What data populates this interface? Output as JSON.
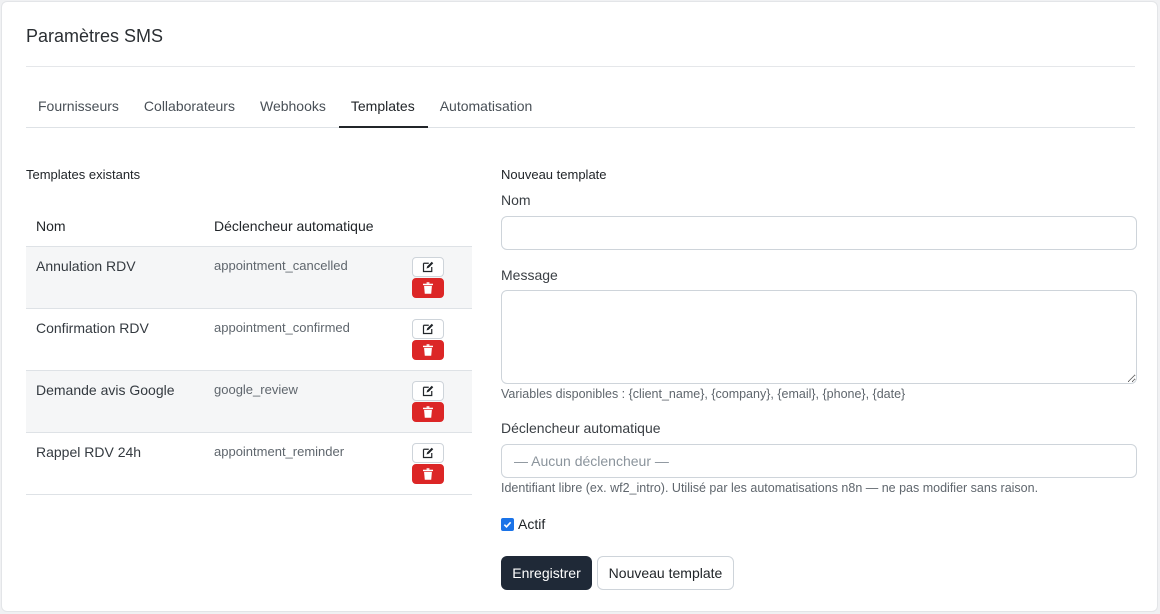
{
  "page": {
    "title": "Paramètres SMS"
  },
  "tabs": [
    {
      "label": "Fournisseurs",
      "active": false
    },
    {
      "label": "Collaborateurs",
      "active": false
    },
    {
      "label": "Webhooks",
      "active": false
    },
    {
      "label": "Templates",
      "active": true
    },
    {
      "label": "Automatisation",
      "active": false
    }
  ],
  "templates": {
    "heading": "Templates existants",
    "columns": {
      "name": "Nom",
      "trigger": "Déclencheur automatique"
    },
    "rows": [
      {
        "name": "Annulation RDV",
        "trigger": "appointment_cancelled"
      },
      {
        "name": "Confirmation RDV",
        "trigger": "appointment_confirmed"
      },
      {
        "name": "Demande avis Google",
        "trigger": "google_review"
      },
      {
        "name": "Rappel RDV 24h",
        "trigger": "appointment_reminder"
      }
    ],
    "icons": {
      "edit": "edit-icon",
      "delete": "trash-icon"
    }
  },
  "form": {
    "heading": "Nouveau template",
    "name_label": "Nom",
    "name_value": "",
    "message_label": "Message",
    "message_value": "",
    "variables_help": "Variables disponibles : {client_name}, {company}, {email}, {phone}, {date}",
    "trigger_label": "Déclencheur automatique",
    "trigger_placeholder": "— Aucun déclencheur —",
    "trigger_help": "Identifiant libre (ex. wf2_intro). Utilisé par les automatisations n8n — ne pas modifier sans raison.",
    "active_label": "Actif",
    "active_checked": true,
    "save_label": "Enregistrer",
    "new_label": "Nouveau template"
  },
  "colors": {
    "primary": "#1f2937",
    "danger": "#dc2626",
    "checkbox": "#1a73e8"
  }
}
